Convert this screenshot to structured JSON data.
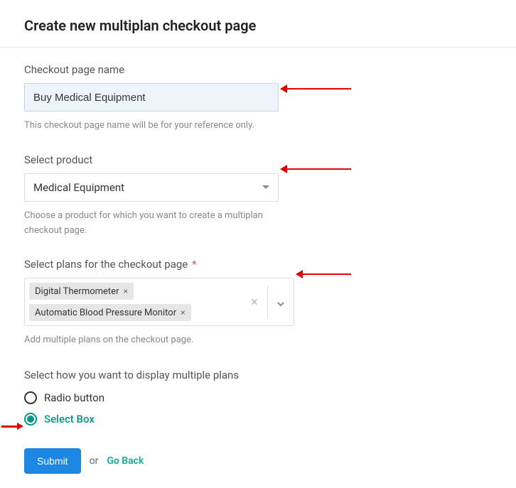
{
  "page": {
    "title": "Create new multiplan checkout page"
  },
  "fields": {
    "name": {
      "label": "Checkout page name",
      "value": "Buy Medical Equipment",
      "helper": "This checkout page name will be for your reference only."
    },
    "product": {
      "label": "Select product",
      "value": "Medical Equipment",
      "helper": "Choose a product for which you want to create a multiplan checkout page."
    },
    "plans": {
      "label": "Select plans for the checkout page",
      "required_marker": "*",
      "tags": [
        "Digital Thermometer",
        "Automatic Blood Pressure Monitor"
      ],
      "remove_glyph": "×",
      "helper": "Add multiple plans on the checkout page."
    },
    "display": {
      "label": "Select how you want to display multiple plans",
      "options": {
        "radio": "Radio button",
        "select": "Select Box"
      },
      "selected": "select"
    }
  },
  "actions": {
    "submit": "Submit",
    "or": "or",
    "go_back": "Go Back"
  }
}
